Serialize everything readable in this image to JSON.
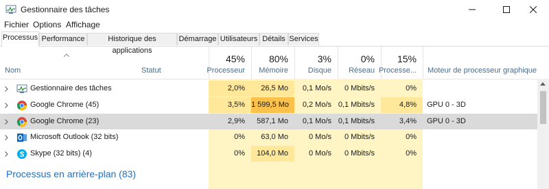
{
  "window": {
    "title": "Gestionnaire des tâches",
    "controls": [
      "minimize",
      "maximize",
      "close"
    ]
  },
  "menu": [
    "Fichier",
    "Options",
    "Affichage"
  ],
  "tabs": [
    {
      "label": "Processus",
      "active": true
    },
    {
      "label": "Performance"
    },
    {
      "label": "Historique des applications"
    },
    {
      "label": "Démarrage"
    },
    {
      "label": "Utilisateurs"
    },
    {
      "label": "Détails"
    },
    {
      "label": "Services"
    }
  ],
  "columns": {
    "name": "Nom",
    "status": "Statut",
    "cpu": {
      "pct": "45%",
      "label": "Processeur"
    },
    "mem": {
      "pct": "80%",
      "label": "Mémoire"
    },
    "disk": {
      "pct": "3%",
      "label": "Disque"
    },
    "net": {
      "pct": "0%",
      "label": "Réseau"
    },
    "gpu": {
      "pct": "15%",
      "label": "Processe..."
    },
    "gpu_engine": "Moteur de processeur graphique"
  },
  "rows": [
    {
      "name": "Gestionnaire des tâches",
      "icon": "task-manager-icon",
      "cpu": "2,0%",
      "mem": "26,5 Mo",
      "disk": "0,1 Mo/s",
      "net": "0 Mbits/s",
      "gpu": "0%",
      "engine": ""
    },
    {
      "name": "Google Chrome (45)",
      "icon": "chrome-icon",
      "cpu": "3,5%",
      "mem": "1 599,5 Mo",
      "disk": "0,2 Mo/s",
      "net": "0,1 Mbits/s",
      "gpu": "4,8%",
      "engine": "GPU 0 - 3D"
    },
    {
      "name": "Google Chrome (23)",
      "icon": "chrome-icon",
      "cpu": "2,9%",
      "mem": "587,1 Mo",
      "disk": "0,1 Mo/s",
      "net": "0,1 Mbits/s",
      "gpu": "3,4%",
      "engine": "GPU 0 - 3D",
      "selected": true
    },
    {
      "name": "Microsoft Outlook (32 bits)",
      "icon": "outlook-icon",
      "cpu": "0%",
      "mem": "63,0 Mo",
      "disk": "0 Mo/s",
      "net": "0 Mbits/s",
      "gpu": "0%",
      "engine": ""
    },
    {
      "name": "Skype (32 bits) (4)",
      "icon": "skype-icon",
      "cpu": "0%",
      "mem": "104,0 Mo",
      "disk": "0 Mo/s",
      "net": "0 Mbits/s",
      "gpu": "0%",
      "engine": ""
    }
  ],
  "group_background": "Processus en arrière-plan (83)",
  "colors": {
    "heat_light": "#fff4c4",
    "heat_mid": "#ffe89a",
    "heat_hot": "#fbc14a",
    "accent": "#1f6fc0"
  }
}
